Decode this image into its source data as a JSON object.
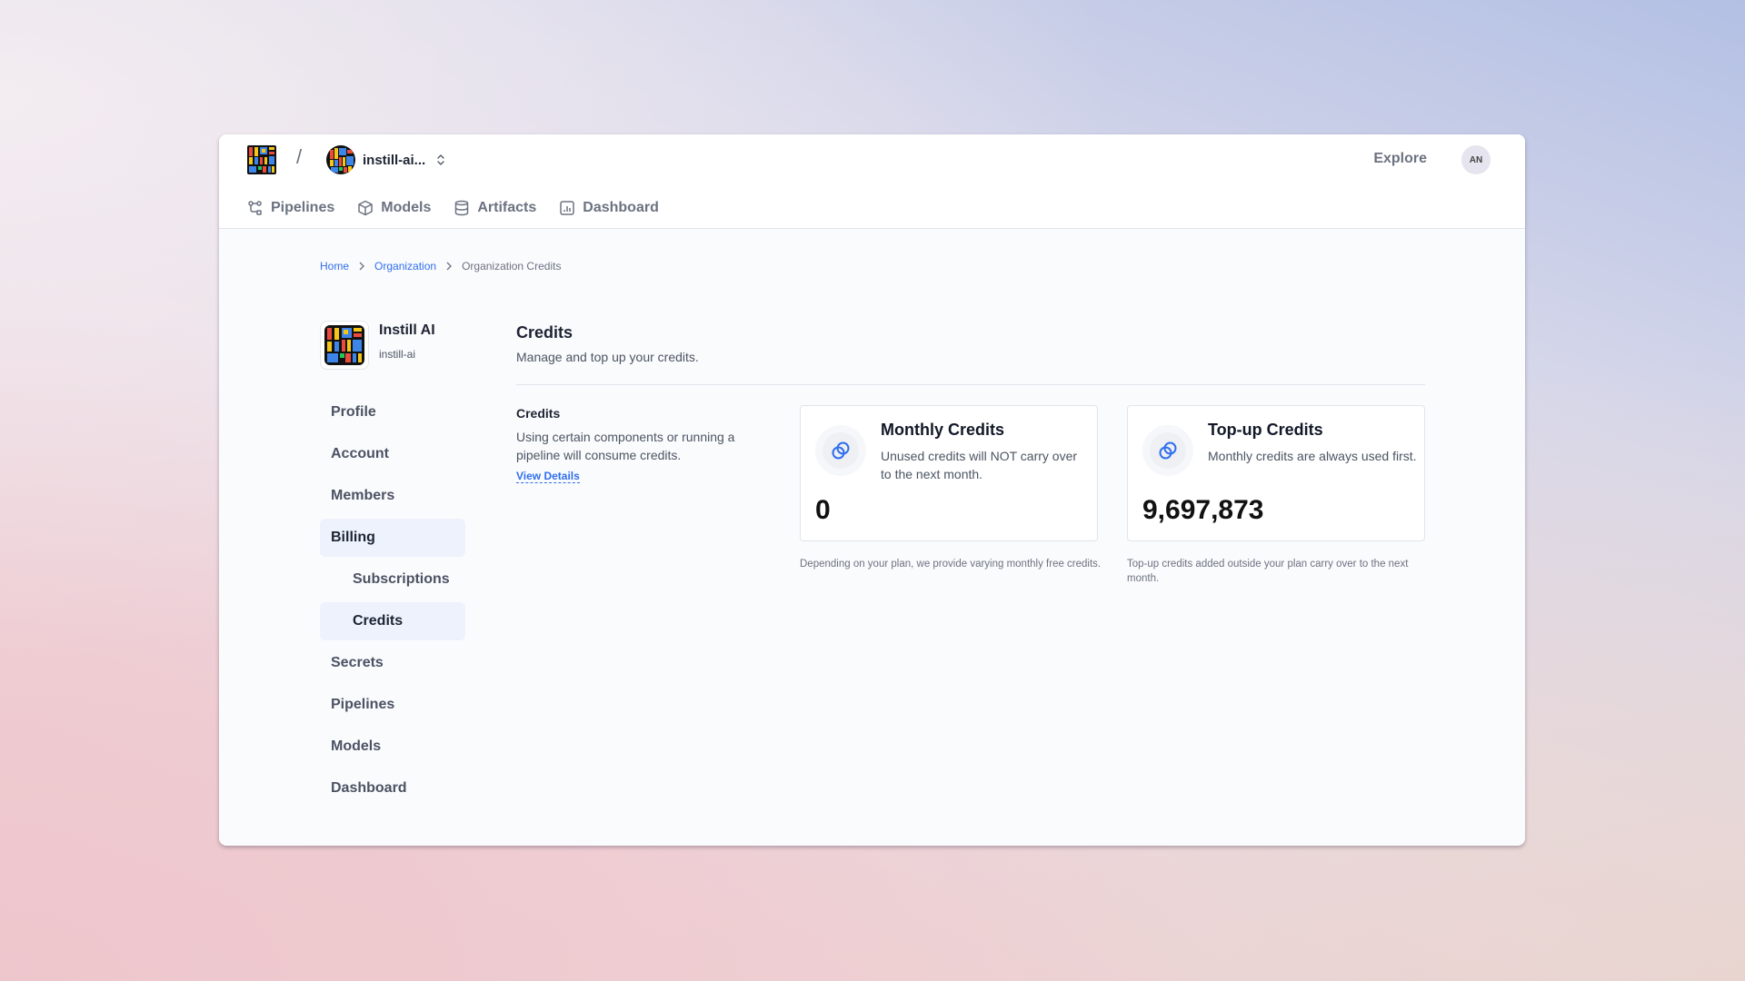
{
  "header": {
    "org_switcher_label": "instill-ai...",
    "explore_label": "Explore",
    "avatar_initials": "AN",
    "nav": [
      {
        "label": "Pipelines",
        "icon": "pipeline-icon"
      },
      {
        "label": "Models",
        "icon": "cube-icon"
      },
      {
        "label": "Artifacts",
        "icon": "database-icon"
      },
      {
        "label": "Dashboard",
        "icon": "bar-chart-icon"
      }
    ]
  },
  "breadcrumb": {
    "items": [
      "Home",
      "Organization",
      "Organization Credits"
    ]
  },
  "organization": {
    "name": "Instill AI",
    "handle": "instill-ai"
  },
  "sidebar": {
    "items": [
      {
        "label": "Profile"
      },
      {
        "label": "Account"
      },
      {
        "label": "Members"
      },
      {
        "label": "Billing",
        "active": true
      },
      {
        "label": "Subscriptions",
        "sub": true
      },
      {
        "label": "Credits",
        "sub": true,
        "active": true
      },
      {
        "label": "Secrets"
      },
      {
        "label": "Pipelines"
      },
      {
        "label": "Models"
      },
      {
        "label": "Dashboard"
      }
    ]
  },
  "page": {
    "title": "Credits",
    "subtitle": "Manage and top up your credits.",
    "section": {
      "title": "Credits",
      "description": "Using certain components or running a pipeline will consume credits.",
      "link_label": "View Details"
    },
    "cards": [
      {
        "title": "Monthly Credits",
        "description": "Unused credits will NOT carry over to the next month.",
        "value": "0",
        "note": "Depending on your plan, we provide varying monthly free credits."
      },
      {
        "title": "Top-up Credits",
        "description": "Monthly credits are always used first.",
        "value": "9,697,873",
        "note": "Top-up credits added outside your plan carry over to the next month."
      }
    ]
  },
  "colors": {
    "accent": "#316fed",
    "active_bg": "#eef2fc"
  }
}
